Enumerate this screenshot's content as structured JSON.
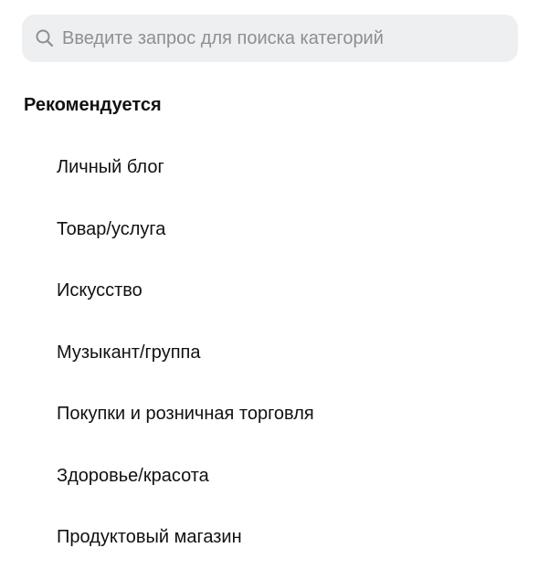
{
  "search": {
    "placeholder": "Введите запрос для поиска категорий",
    "value": "",
    "icon": "search-icon"
  },
  "section": {
    "title": "Рекомендуется"
  },
  "categories": [
    {
      "label": "Личный блог"
    },
    {
      "label": "Товар/услуга"
    },
    {
      "label": "Искусство"
    },
    {
      "label": "Музыкант/группа"
    },
    {
      "label": "Покупки и розничная торговля"
    },
    {
      "label": "Здоровье/красота"
    },
    {
      "label": "Продуктовый магазин"
    }
  ],
  "colors": {
    "search_background": "#eeeff1",
    "placeholder": "#8e8e93",
    "text": "#111111"
  }
}
